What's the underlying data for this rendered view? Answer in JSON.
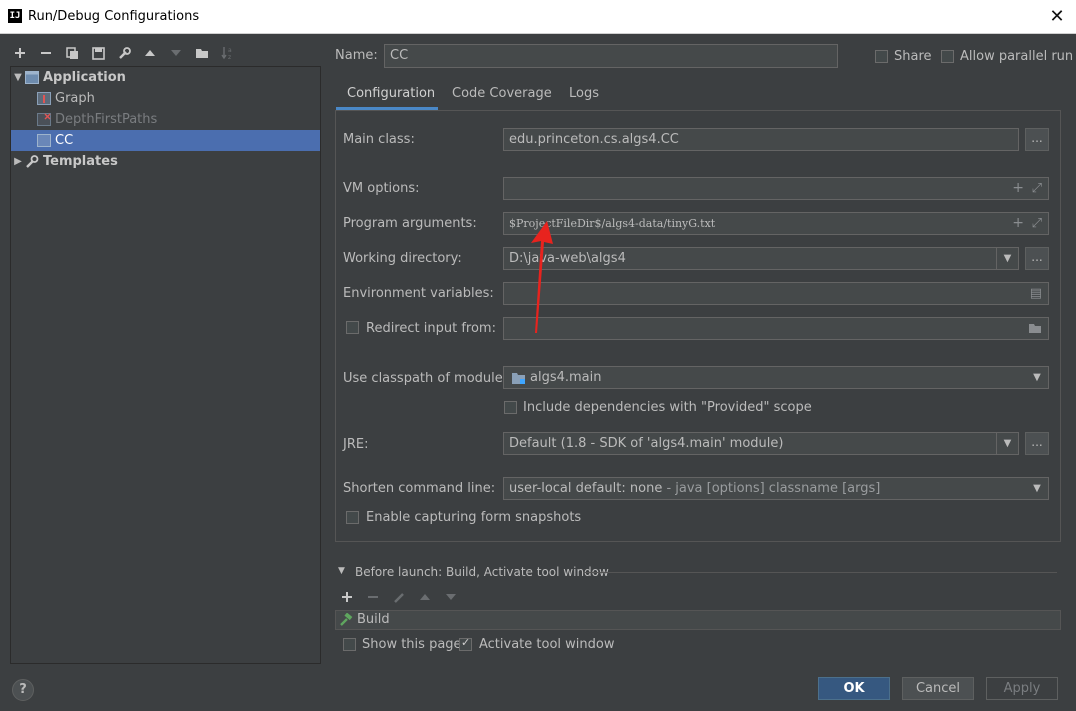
{
  "window": {
    "title": "Run/Debug Configurations",
    "app_icon": "IJ"
  },
  "toolbar": {
    "icons": [
      "add-icon",
      "remove-icon",
      "copy-icon",
      "save-icon",
      "wrench-icon",
      "move-up-icon",
      "move-down-icon",
      "folder-icon",
      "sort-icon"
    ]
  },
  "tree": {
    "application": "Application",
    "graph": "Graph",
    "depth_first": "DepthFirstPaths",
    "cc": "CC",
    "templates": "Templates"
  },
  "header": {
    "name_label": "Name:",
    "name_value": "CC",
    "share_label": "Share",
    "parallel_label": "Allow parallel run"
  },
  "tabs": [
    "Configuration",
    "Code Coverage",
    "Logs"
  ],
  "form": {
    "main_class_label": "Main class:",
    "main_class_value": "edu.princeton.cs.algs4.CC",
    "vm_options_label": "VM options:",
    "vm_options_value": "",
    "program_args_label": "Program arguments:",
    "program_args_value": "$ProjectFileDir$/algs4-data/tinyG.txt",
    "working_dir_label": "Working directory:",
    "working_dir_value": "D:\\java-web\\algs4",
    "env_vars_label": "Environment variables:",
    "env_vars_value": "",
    "redirect_label": "Redirect input from:",
    "redirect_value": "",
    "classpath_label": "Use classpath of module:",
    "classpath_value": "algs4.main",
    "include_deps_label": "Include dependencies with \"Provided\" scope",
    "jre_label": "JRE:",
    "jre_value": "Default (1.8 - SDK of 'algs4.main' module)",
    "shorten_label": "Shorten command line:",
    "shorten_value": "user-local default: none",
    "shorten_suffix": " - java [options] classname [args]",
    "snapshots_label": "Enable capturing form snapshots",
    "dots": "..."
  },
  "before_launch": {
    "title": "Before launch: Build, Activate tool window",
    "task": "Build",
    "show_page_label": "Show this page",
    "activate_label": "Activate tool window"
  },
  "buttons": {
    "ok": "OK",
    "cancel": "Cancel",
    "apply": "Apply",
    "help": "?"
  },
  "colors": {
    "selection": "#4b6eaf",
    "annotation_arrow": "#e8231e",
    "accent": "#4a88c7"
  }
}
